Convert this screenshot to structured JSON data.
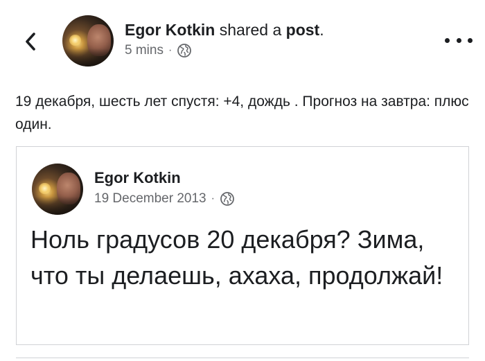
{
  "post": {
    "author_name": "Egor Kotkin",
    "action_text": " shared a ",
    "object_text": "post",
    "trailing_punct": ".",
    "time": "5 mins",
    "separator": "·",
    "text": "19 декабря, шесть лет спустя: +4, дождь . Прогноз на завтра: плюс один."
  },
  "shared": {
    "author_name": "Egor Kotkin",
    "date": "19 December 2013",
    "separator": "·",
    "text": "Ноль градусов 20 декабря? Зима, что ты делаешь, ахаха, продолжай!"
  },
  "icons": {
    "back": "chevron-left-icon",
    "more": "more-horizontal-icon",
    "privacy": "globe-icon"
  },
  "colors": {
    "text_primary": "#1c1e21",
    "text_secondary": "#65676b",
    "border": "#d0d2d6"
  }
}
